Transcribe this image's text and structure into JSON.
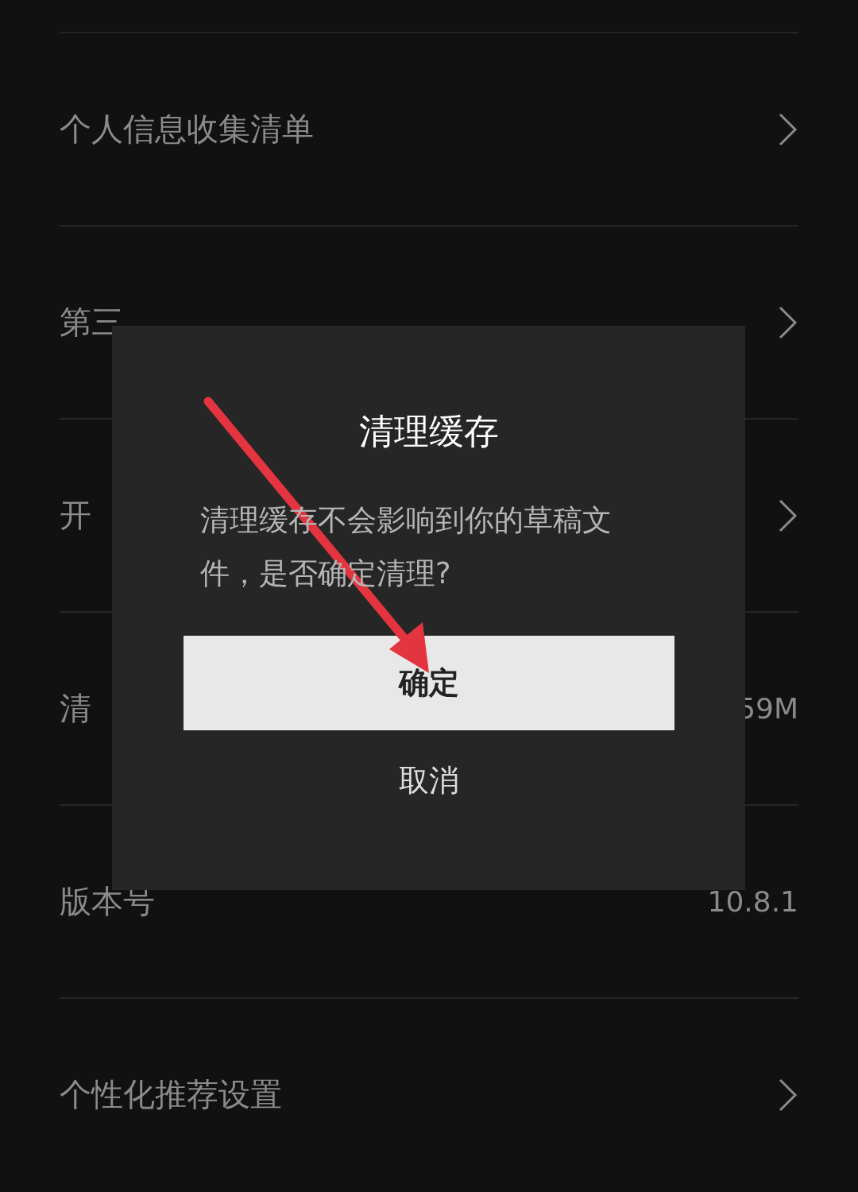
{
  "settings": [
    {
      "label": "个人信息收集清单",
      "kind": "chevron"
    },
    {
      "label": "第三",
      "kind": "chevron"
    },
    {
      "label": "开",
      "kind": "chevron"
    },
    {
      "label": "清",
      "kind": "value",
      "value": "59M"
    },
    {
      "label": "版本号",
      "kind": "value",
      "value": "10.8.1"
    },
    {
      "label": "个性化推荐设置",
      "kind": "chevron"
    }
  ],
  "dialog": {
    "title": "清理缓存",
    "message": "清理缓存不会影响到你的草稿文件，是否确定清理?",
    "confirm": "确定",
    "cancel": "取消"
  }
}
